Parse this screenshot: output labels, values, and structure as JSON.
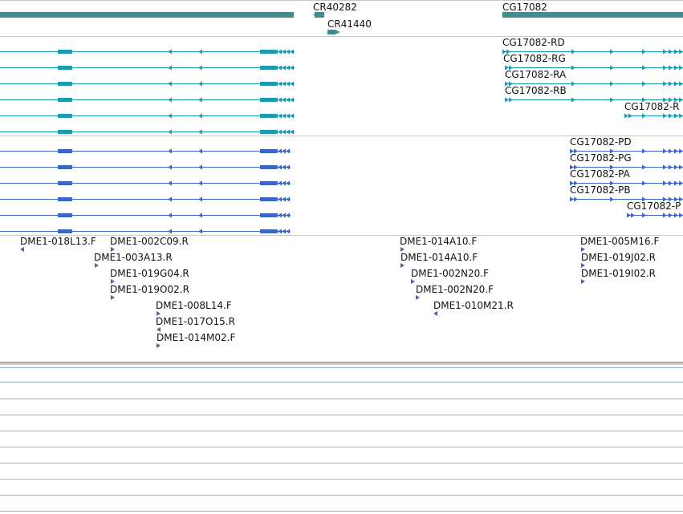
{
  "gene_track": {
    "genes": [
      {
        "label": "CR40282"
      },
      {
        "label": "CR41440"
      },
      {
        "label": "CG17082"
      }
    ]
  },
  "transcript_track": {
    "labels": [
      "CG17082-RD",
      "CG17082-RG",
      "CG17082-RA",
      "CG17082-RB",
      "CG17082-R"
    ]
  },
  "protein_track": {
    "labels": [
      "CG17082-PD",
      "CG17082-PG",
      "CG17082-PA",
      "CG17082-PB",
      "CG17082-P"
    ]
  },
  "clone_track": {
    "labels": [
      "DME1-018L13.F",
      "DME1-002C09.R",
      "DME1-003A13.R",
      "DME1-019G04.R",
      "DME1-019O02.R",
      "DME1-008L14.F",
      "DME1-017O15.R",
      "DME1-014M02.F",
      "DME1-014A10.F",
      "DME1-014A10.F",
      "DME1-002N20.F",
      "DME1-002N20.F",
      "DME1-010M21.R",
      "DME1-005M16.F",
      "DME1-019J02.R",
      "DME1-019I02.R"
    ]
  },
  "colors": {
    "gene": "#3d8e8e",
    "transcript": "#1a9bb0",
    "protein": "#3a66c4",
    "clone": "#6655aa",
    "divider": "#c8c8c8",
    "grid": "#8fb8cc"
  }
}
